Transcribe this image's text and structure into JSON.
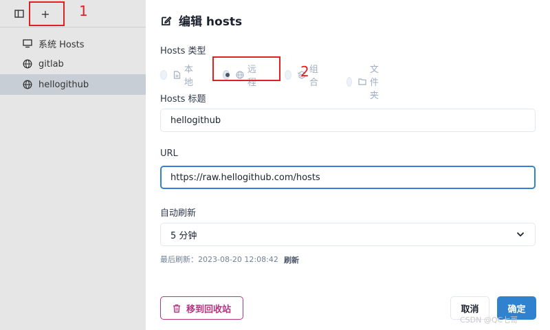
{
  "sidebar": {
    "items": [
      {
        "label": "系统 Hosts",
        "icon": "monitor-icon"
      },
      {
        "label": "gitlab",
        "icon": "globe-icon"
      },
      {
        "label": "hellogithub",
        "icon": "globe-icon",
        "active": true
      }
    ]
  },
  "toolbar": {
    "add_label": "+"
  },
  "annotations": {
    "one": "1",
    "two": "2"
  },
  "modal": {
    "title": "编辑 hosts",
    "type_label": "Hosts 类型",
    "types": [
      {
        "label": "本地",
        "icon": "file-icon"
      },
      {
        "label": "远程",
        "icon": "globe-icon",
        "checked": true
      },
      {
        "label": "组合",
        "icon": "layers-icon"
      },
      {
        "label": "文件夹",
        "icon": "folder-icon"
      }
    ],
    "title_label": "Hosts 标题",
    "title_value": "hellogithub",
    "url_label": "URL",
    "url_value": "https://raw.hellogithub.com/hosts",
    "refresh_label": "自动刷新",
    "refresh_value": "5 分钟",
    "last_refresh": "最后刷新：2023-08-20 12:08:42",
    "refresh_link": "刷新",
    "trash_button": "移到回收站",
    "cancel_button": "取消",
    "ok_button": "确定"
  },
  "watermark": "CSDN @QC七哥",
  "colors": {
    "accent": "#3182ce",
    "danger": "#b83280",
    "annotation": "#e02020"
  }
}
